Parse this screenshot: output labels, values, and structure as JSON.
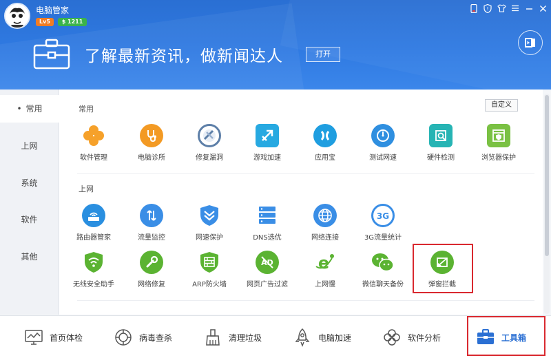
{
  "app": {
    "title": "电脑管家",
    "level": "Lv5",
    "coins": "$ 1211"
  },
  "banner": {
    "slogan": "了解最新资讯，做新闻达人",
    "open_label": "打开"
  },
  "sidebar": {
    "items": [
      {
        "label": "常用",
        "active": true
      },
      {
        "label": "上网"
      },
      {
        "label": "系统"
      },
      {
        "label": "软件"
      },
      {
        "label": "其他"
      }
    ]
  },
  "content": {
    "custom_label": "自定义",
    "sections": [
      {
        "title": "常用",
        "tools": [
          {
            "label": "软件管理",
            "icon": "clover-icon",
            "color": "#f6a12a"
          },
          {
            "label": "电脑诊所",
            "icon": "stethoscope-icon",
            "color": "#f39a24"
          },
          {
            "label": "修复漏洞",
            "icon": "patch-icon",
            "color": "#5d7fa8"
          },
          {
            "label": "游戏加速",
            "icon": "game-boost-icon",
            "color": "#27a9e1"
          },
          {
            "label": "应用宝",
            "icon": "app-store-icon",
            "color": "#1f9ee0"
          },
          {
            "label": "测试网速",
            "icon": "speed-test-icon",
            "color": "#2f8fe0"
          },
          {
            "label": "硬件检测",
            "icon": "chip-search-icon",
            "color": "#26b4b4"
          },
          {
            "label": "浏览器保护",
            "icon": "browser-shield-icon",
            "color": "#7ac143"
          }
        ]
      },
      {
        "title": "上网",
        "tools": [
          {
            "label": "路由器管家",
            "icon": "router-icon",
            "color": "#2a8fe0"
          },
          {
            "label": "流量监控",
            "icon": "traffic-monitor-icon",
            "color": "#3a8ee6"
          },
          {
            "label": "网速保护",
            "icon": "speed-shield-icon",
            "color": "#3a8ee6"
          },
          {
            "label": "DNS选优",
            "icon": "dns-server-icon",
            "color": "#3a8ee6"
          },
          {
            "label": "网络连接",
            "icon": "globe-icon",
            "color": "#3a8ee6"
          },
          {
            "label": "3G流量统计",
            "icon": "3g-icon",
            "color": "#3a8ee6"
          },
          {
            "label": "无线安全助手",
            "icon": "wifi-shield-icon",
            "color": "#5bb332"
          },
          {
            "label": "网络修复",
            "icon": "wrench-icon",
            "color": "#5bb332"
          },
          {
            "label": "ARP防火墙",
            "icon": "firewall-icon",
            "color": "#5bb332"
          },
          {
            "label": "网页广告过滤",
            "icon": "ad-block-icon",
            "color": "#5bb332"
          },
          {
            "label": "上网慢",
            "icon": "slow-net-icon",
            "color": "#5bb332"
          },
          {
            "label": "微信聊天备份",
            "icon": "wechat-icon",
            "color": "#5bb332"
          },
          {
            "label": "弹窗拦截",
            "icon": "popup-block-icon",
            "color": "#5bb332"
          }
        ]
      }
    ]
  },
  "bottom_nav": [
    {
      "label": "首页体检",
      "icon": "monitor-check-icon"
    },
    {
      "label": "病毒查杀",
      "icon": "virus-scan-icon"
    },
    {
      "label": "清理垃圾",
      "icon": "broom-icon"
    },
    {
      "label": "电脑加速",
      "icon": "rocket-icon"
    },
    {
      "label": "软件分析",
      "icon": "clover-outline-icon"
    },
    {
      "label": "工具箱",
      "icon": "toolbox-icon",
      "active": true
    }
  ]
}
